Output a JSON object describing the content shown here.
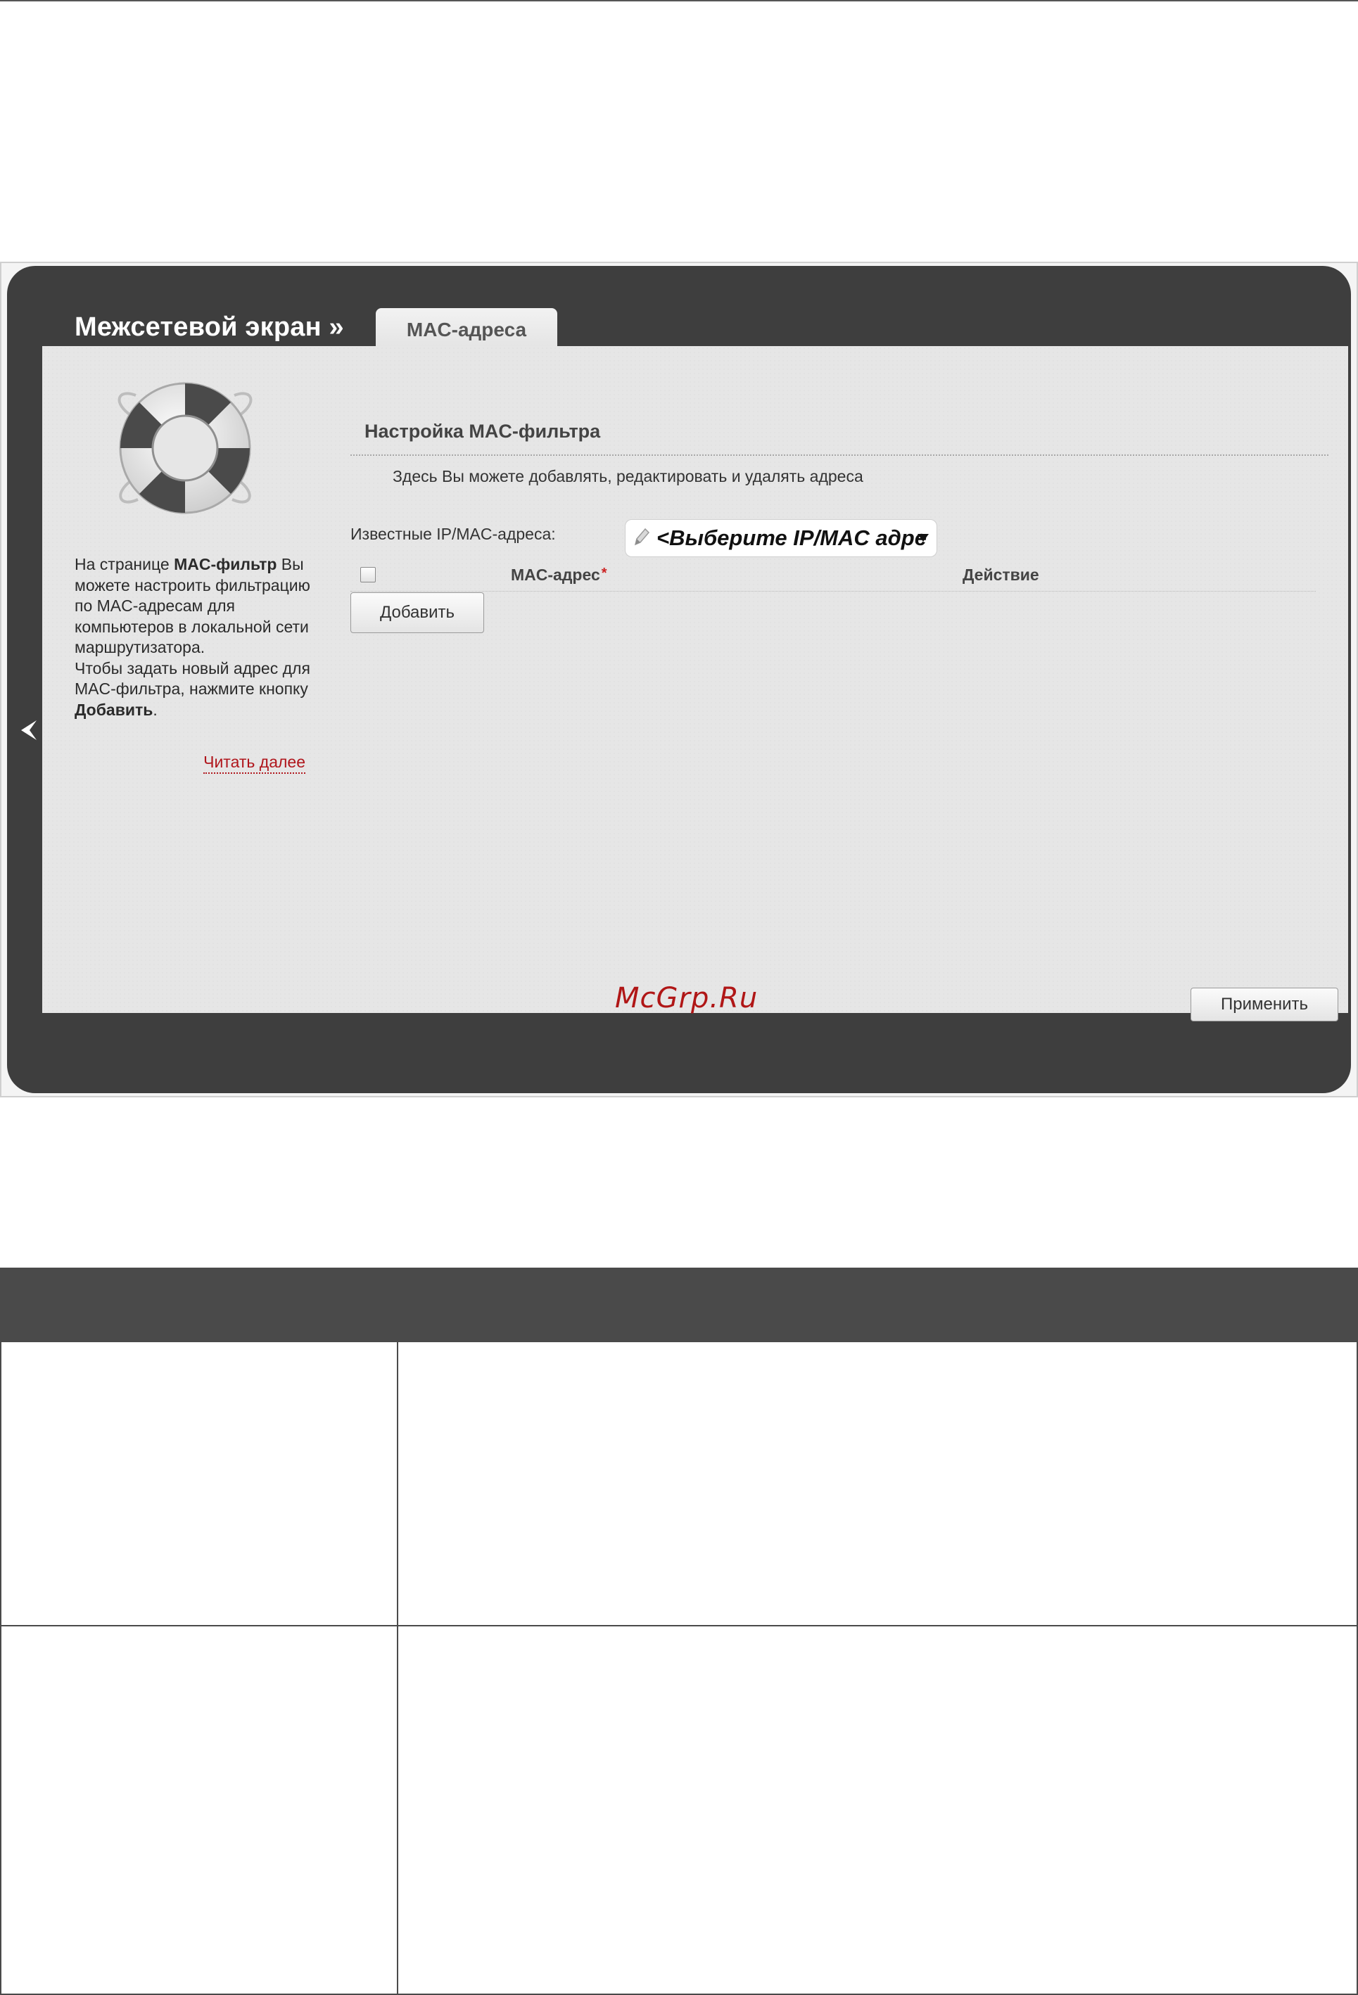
{
  "window": {
    "breadcrumb": "Межсетевой экран »",
    "active_tab": "MAC-адреса"
  },
  "help": {
    "text_before_bold": "На странице ",
    "bold_term": "MAC-фильтр",
    "text_after_bold": " Вы можете настроить фильтрацию по MAC-адресам для компьютеров в локальной сети маршрутизатора.",
    "text2_before": "Чтобы задать новый адрес для MAC-фильтра, нажмите кнопку ",
    "text2_bold": "Добавить",
    "text2_after": ".",
    "read_more": "Читать далее"
  },
  "section": {
    "title": "Настройка MAC-фильтра",
    "description": "Здесь Вы можете добавлять, редактировать и удалять адреса"
  },
  "known_addresses": {
    "label": "Известные IP/MAC-адреса:",
    "selected_value": "<Выберите IP/MAC адре"
  },
  "table": {
    "columns": [
      "MAC-адрес",
      "Действие"
    ],
    "required_mark": "*",
    "rows": []
  },
  "buttons": {
    "add": "Добавить",
    "apply": "Применить"
  },
  "watermark": "McGrp.Ru",
  "colors": {
    "frame": "#3e3e3e",
    "panel": "#e6e6e6",
    "link": "#b0161c",
    "watermark": "#b01616",
    "table_header": "#4a4a4a"
  },
  "icons": [
    "lifebuoy-icon",
    "back-arrow-icon",
    "pencil-icon",
    "chevron-down-icon"
  ]
}
